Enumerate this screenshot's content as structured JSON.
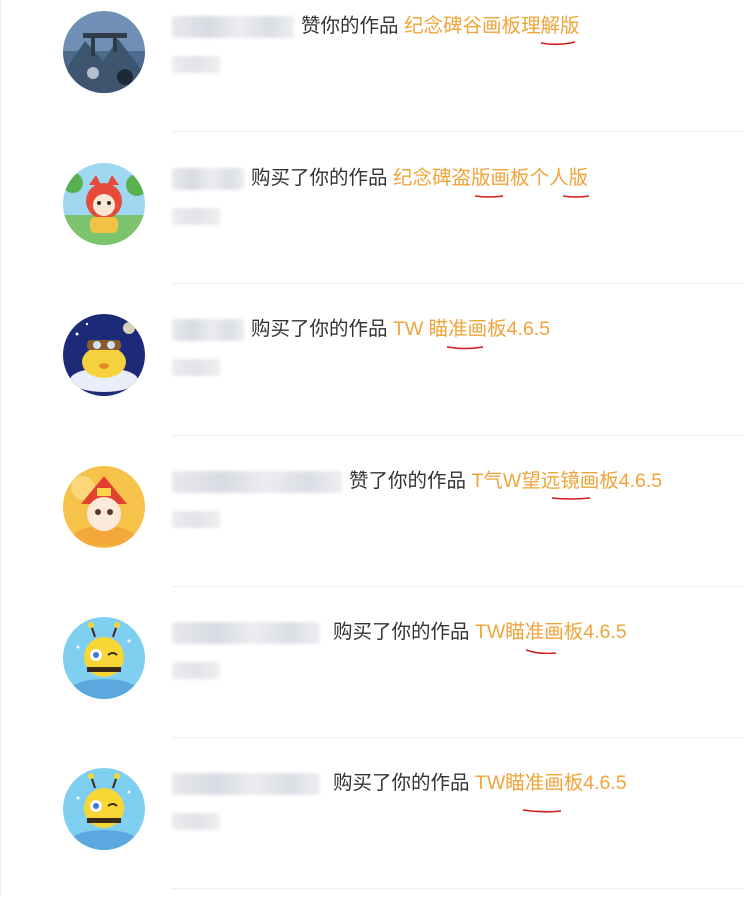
{
  "feed": {
    "items": [
      {
        "avatar": "avatar-landscape-mountain-icon",
        "action": "赞你的作品",
        "work": "纪念碑谷画板理解版"
      },
      {
        "avatar": "avatar-cartoon-red-fox-icon",
        "action": "购买了你的作品",
        "work": "纪念碑盗版画板个人版"
      },
      {
        "avatar": "avatar-cartoon-yellow-car-icon",
        "action": "购买了你的作品",
        "work": "TW 瞄准画板4.6.5"
      },
      {
        "avatar": "avatar-cartoon-red-hat-cat-icon",
        "action": "赞了你的作品",
        "work": "T气W望远镜画板4.6.5"
      },
      {
        "avatar": "avatar-cartoon-yellow-bee-icon",
        "action": "购买了你的作品",
        "work": "TW瞄准画板4.6.5"
      },
      {
        "avatar": "avatar-cartoon-yellow-bee-icon",
        "action": "购买了你的作品",
        "work": "TW瞄准画板4.6.5"
      }
    ]
  },
  "colors": {
    "work_link": "#f0a43a",
    "action_text": "#333333",
    "annotation_mark": "#d21a1a",
    "divider": "#ededed"
  }
}
